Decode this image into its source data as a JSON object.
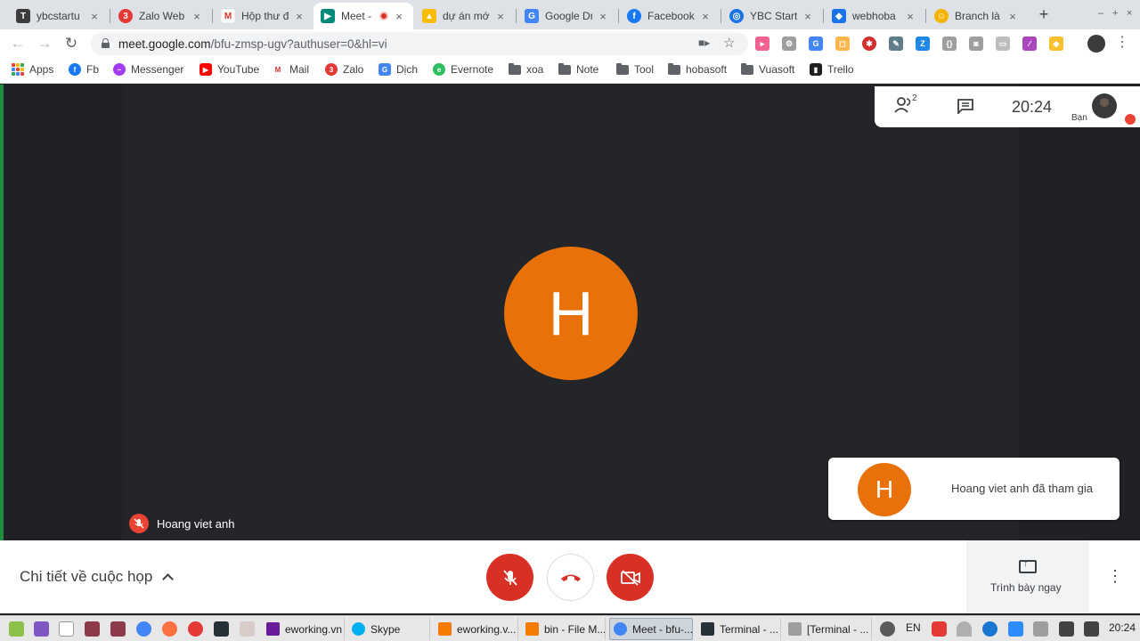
{
  "colors": {
    "tabstrip_bg": "#dee1e6",
    "meet_bg": "#202124",
    "avatar_orange": "#e8710a",
    "danger_red": "#d93025",
    "accent_green": "#1e8e3e"
  },
  "tabs": [
    {
      "title": "ybcstartu",
      "icon": "tab-favicon-ybc",
      "active": false
    },
    {
      "title": "Zalo Web",
      "icon": "zalo-icon",
      "active": false
    },
    {
      "title": "Hộp thư đ",
      "icon": "gmail-icon",
      "active": false
    },
    {
      "title": "Meet -",
      "icon": "meet-icon",
      "active": true
    },
    {
      "title": "dự án mới",
      "icon": "drive-icon",
      "active": false
    },
    {
      "title": "Google Dr",
      "icon": "docs-icon",
      "active": false
    },
    {
      "title": "Facebook",
      "icon": "facebook-icon",
      "active": false
    },
    {
      "title": "YBC Start",
      "icon": "globe-icon",
      "active": false
    },
    {
      "title": "webhoba",
      "icon": "shield-icon",
      "active": false
    },
    {
      "title": "Branch là",
      "icon": "person-icon",
      "active": false
    }
  ],
  "tab_close_glyph": "×",
  "new_tab_glyph": "+",
  "window_controls": [
    "–",
    "+",
    "×"
  ],
  "address": {
    "host": "meet.google.com",
    "path": "/bfu-zmsp-ugv?authuser=0&hl=vi"
  },
  "nav": {
    "back": "←",
    "forward": "→",
    "reload": "↻"
  },
  "bookmarks": [
    {
      "label": "Apps",
      "icon": "apps-grid-icon"
    },
    {
      "label": "Fb",
      "icon": "facebook-icon"
    },
    {
      "label": "Messenger",
      "icon": "messenger-icon"
    },
    {
      "label": "YouTube",
      "icon": "youtube-icon"
    },
    {
      "label": "Mail",
      "icon": "gmail-icon"
    },
    {
      "label": "Zalo",
      "icon": "zalo-icon"
    },
    {
      "label": "Dịch",
      "icon": "translate-icon"
    },
    {
      "label": "Evernote",
      "icon": "evernote-icon"
    },
    {
      "label": "xoa",
      "icon": "folder-icon"
    },
    {
      "label": "Note",
      "icon": "folder-icon"
    },
    {
      "label": "Tool",
      "icon": "folder-icon"
    },
    {
      "label": "hobasoft",
      "icon": "folder-icon"
    },
    {
      "label": "Vuasoft",
      "icon": "folder-icon"
    },
    {
      "label": "Trello",
      "icon": "trello-icon"
    }
  ],
  "meeting": {
    "participant_initial": "H",
    "participant_name": "Hoang viet anh",
    "people_count": "2",
    "time": "20:24",
    "self_label": "Bạn",
    "join_notice": "Hoang viet anh đã tham gia",
    "details_label": "Chi tiết về cuộc họp",
    "present_label": "Trình bày ngay"
  },
  "taskbar": {
    "windows": [
      {
        "label": "eworking.vn",
        "icon": "app-icon",
        "active": false
      },
      {
        "label": "Skype",
        "icon": "skype-icon",
        "active": false
      },
      {
        "label": "eworking.v...",
        "icon": "folder-icon",
        "active": false
      },
      {
        "label": "bin - File M...",
        "icon": "folder-icon",
        "active": false
      },
      {
        "label": "Meet - bfu-...",
        "icon": "chrome-icon",
        "active": true
      },
      {
        "label": "Terminal - ...",
        "icon": "terminal-icon",
        "active": false
      },
      {
        "label": "[Terminal - ...",
        "icon": "terminal-icon",
        "active": false
      }
    ],
    "lang": "EN",
    "clock": "20:24"
  }
}
